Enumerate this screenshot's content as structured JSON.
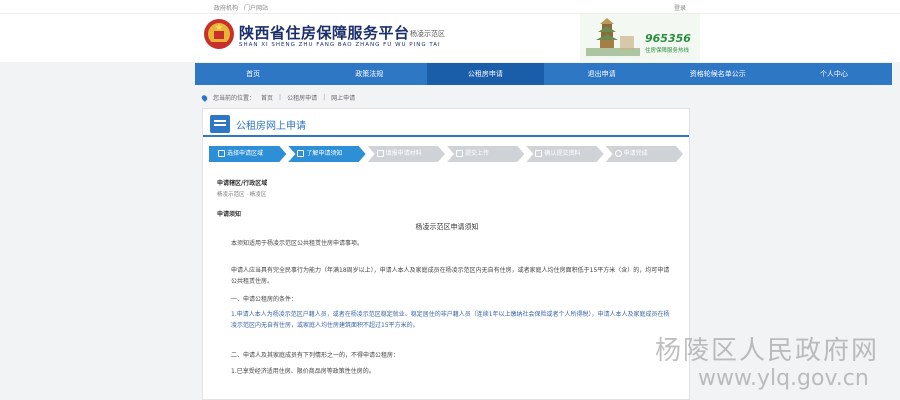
{
  "topbar": {
    "left_links": [
      "政府机构",
      "门户网站"
    ],
    "right_links": [
      "登录"
    ]
  },
  "header": {
    "title": "陕西省住房保障服务平台",
    "subtitle": "SHAN XI SHENG ZHU FANG BAO ZHANG FU WU PING TAI",
    "area": "杨凌示范区",
    "hotline": "965356",
    "hotline_sub": "住房保障服务热线"
  },
  "nav": {
    "items": [
      "首页",
      "政策法规",
      "公租房申请",
      "退出申请",
      "资格轮候名单公示",
      "个人中心"
    ],
    "active_index": 2
  },
  "breadcrumb": {
    "label": "您当前的位置：",
    "items": [
      "首页",
      "公租房申请",
      "网上申请"
    ]
  },
  "panel": {
    "title": "公租房网上申请"
  },
  "steps": [
    {
      "label": "选择申请区域",
      "state": "done"
    },
    {
      "label": "了解申请须知",
      "state": "done"
    },
    {
      "label": "填报申请材料",
      "state": "todo"
    },
    {
      "label": "提交上传",
      "state": "todo"
    },
    {
      "label": "确认提交资料",
      "state": "todo"
    },
    {
      "label": "申请完成",
      "state": "todo"
    }
  ],
  "form": {
    "region_label": "申请辖区/行政区域",
    "region_value": "杨凌示范区 · 杨凌区",
    "notice_label": "申请须知"
  },
  "notice": {
    "title": "杨凌示范区申请须知",
    "paras": [
      "本须知适用于杨凌示范区公共租赁住房申请事项。",
      "申请人应当具有完全民事行为能力（年满18周岁以上），申请人本人及家庭成员在杨凌示范区内无自有住房，或者家庭人均住房面积低于15平方米（含）的，均可申请公共租赁住房。",
      "一、申请公租房的条件：",
      "1.申请人本人为杨凌示范区户籍人员，或者在杨凌示范区稳定就业、稳定居住的非户籍人员（连续1年以上缴纳社会保险或者个人所得税），申请人本人及家庭成员在杨凌示范区内无自有住房，或家庭人均住房建筑面积不超过15平方米的。",
      "二、申请人及其家庭成员有下列情形之一的，不得申请公租房：",
      "1.已享受经济适用住房、限价商品房等政策性住房的。"
    ]
  },
  "watermark": {
    "cn": "杨陵区人民政府网",
    "en": "www.ylq.gov.cn"
  },
  "colors": {
    "primary": "#2d77c5",
    "nav_active": "#1a5da9",
    "step_done": "#2d8fd6",
    "step_todo": "#cfd3d8",
    "title_navy": "#1b2f6b",
    "hotline_green": "#2a8f3f"
  }
}
